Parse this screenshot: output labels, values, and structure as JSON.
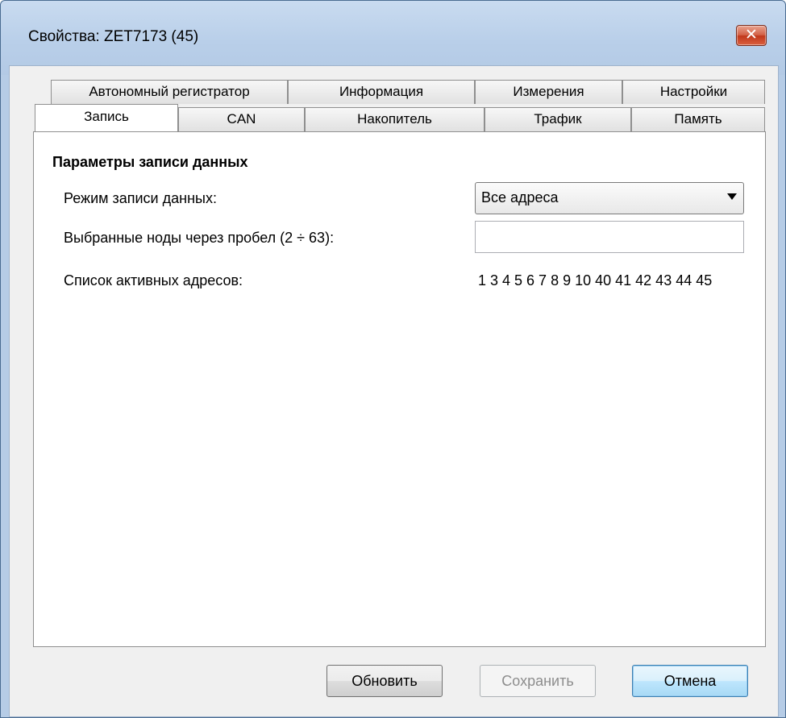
{
  "window": {
    "title": "Свойства: ZET7173 (45)",
    "close_glyph": "✕"
  },
  "tabs_row1": [
    {
      "label": "Автономный регистратор"
    },
    {
      "label": "Информация"
    },
    {
      "label": "Измерения"
    },
    {
      "label": "Настройки"
    }
  ],
  "tabs_row2": [
    {
      "label": "Запись",
      "selected": true
    },
    {
      "label": "CAN"
    },
    {
      "label": "Накопитель"
    },
    {
      "label": "Трафик"
    },
    {
      "label": "Память"
    }
  ],
  "panel": {
    "section_title": "Параметры записи данных",
    "mode_label": "Режим записи данных:",
    "mode_value": "Все адреса",
    "nodes_label": "Выбранные ноды через пробел (2 ÷ 63):",
    "nodes_value": "",
    "active_label": "Список активных адресов:",
    "active_value": "1 3 4 5 6 7 8 9 10 40 41 42 43 44 45"
  },
  "buttons": {
    "refresh": "Обновить",
    "save": "Сохранить",
    "cancel": "Отмена"
  },
  "colors": {
    "frame": "#b6cce6",
    "client": "#f0f0f0",
    "close_button": "#c1381b",
    "default_button": "#bee6fd"
  }
}
